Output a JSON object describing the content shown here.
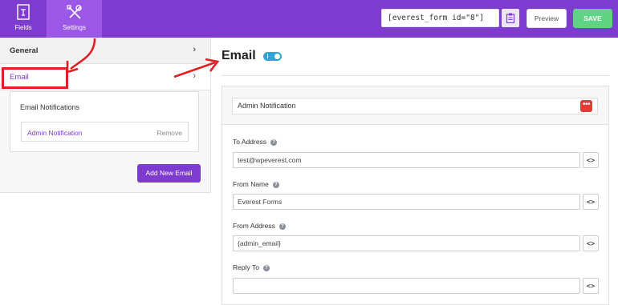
{
  "topbar": {
    "tabs": [
      {
        "label": "Fields",
        "icon": "form-fields-icon"
      },
      {
        "label": "Settings",
        "icon": "wrench-screwdriver-icon"
      }
    ],
    "shortcode": "[everest_form id=\"8\"]",
    "copy_icon": "clipboard-icon",
    "preview_label": "Preview",
    "save_label": "SAVE"
  },
  "sidebar": {
    "general_label": "General",
    "email_label": "Email",
    "notifications_title": "Email Notifications",
    "notification_name": "Admin Notification",
    "remove_label": "Remove",
    "add_new_label": "Add New Email"
  },
  "main": {
    "title": "Email",
    "toggle_on": true,
    "notification_name_value": "Admin Notification",
    "fields": [
      {
        "label": "To Address",
        "value": "test@wpeverest.com"
      },
      {
        "label": "From Name",
        "value": "Everest Forms"
      },
      {
        "label": "From Address",
        "value": "{admin_email}"
      },
      {
        "label": "Reply To",
        "value": ""
      }
    ],
    "help_glyph": "?",
    "code_glyph": "<>"
  },
  "colors": {
    "brand_purple": "#7e3bd0",
    "save_green": "#5cd484",
    "toggle_blue": "#2fa4d9",
    "annotation_red": "#e31e24"
  }
}
